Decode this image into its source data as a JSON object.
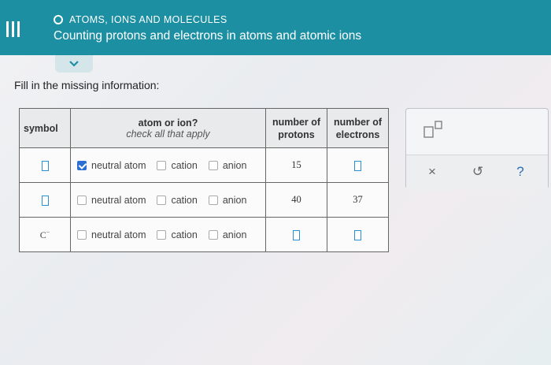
{
  "header": {
    "topic": "ATOMS, IONS AND MOLECULES",
    "subtitle": "Counting protons and electrons in atoms and atomic ions"
  },
  "prompt": "Fill in the missing information:",
  "table": {
    "headers": {
      "symbol": "symbol",
      "atom_or_ion": "atom or ion?",
      "atom_or_ion_sub": "check all that apply",
      "protons_line1": "number of",
      "protons_line2": "protons",
      "electrons_line1": "number of",
      "electrons_line2": "electrons"
    },
    "option_labels": [
      "neutral atom",
      "cation",
      "anion"
    ],
    "rows": [
      {
        "symbol": "",
        "symbol_charge": "",
        "checked": [
          true,
          false,
          false
        ],
        "protons": "15",
        "electrons": ""
      },
      {
        "symbol": "",
        "symbol_charge": "",
        "checked": [
          false,
          false,
          false
        ],
        "protons": "40",
        "electrons": "37"
      },
      {
        "symbol": "C",
        "symbol_charge": "−",
        "checked": [
          false,
          false,
          false
        ],
        "protons": "",
        "electrons": ""
      }
    ]
  },
  "side_panel": {
    "buttons": {
      "clear": "×",
      "undo": "↺",
      "help": "?"
    }
  },
  "icons": {
    "menu": "menu-icon",
    "collapse": "chevron-down-icon",
    "superscript_tool": "superscript-template-icon",
    "clear": "close-icon",
    "undo": "undo-icon",
    "help": "help-icon"
  },
  "colors": {
    "header_bg": "#1c8fa3",
    "input_border": "#2a8fd1",
    "checkbox_checked": "#2a6fd1"
  }
}
